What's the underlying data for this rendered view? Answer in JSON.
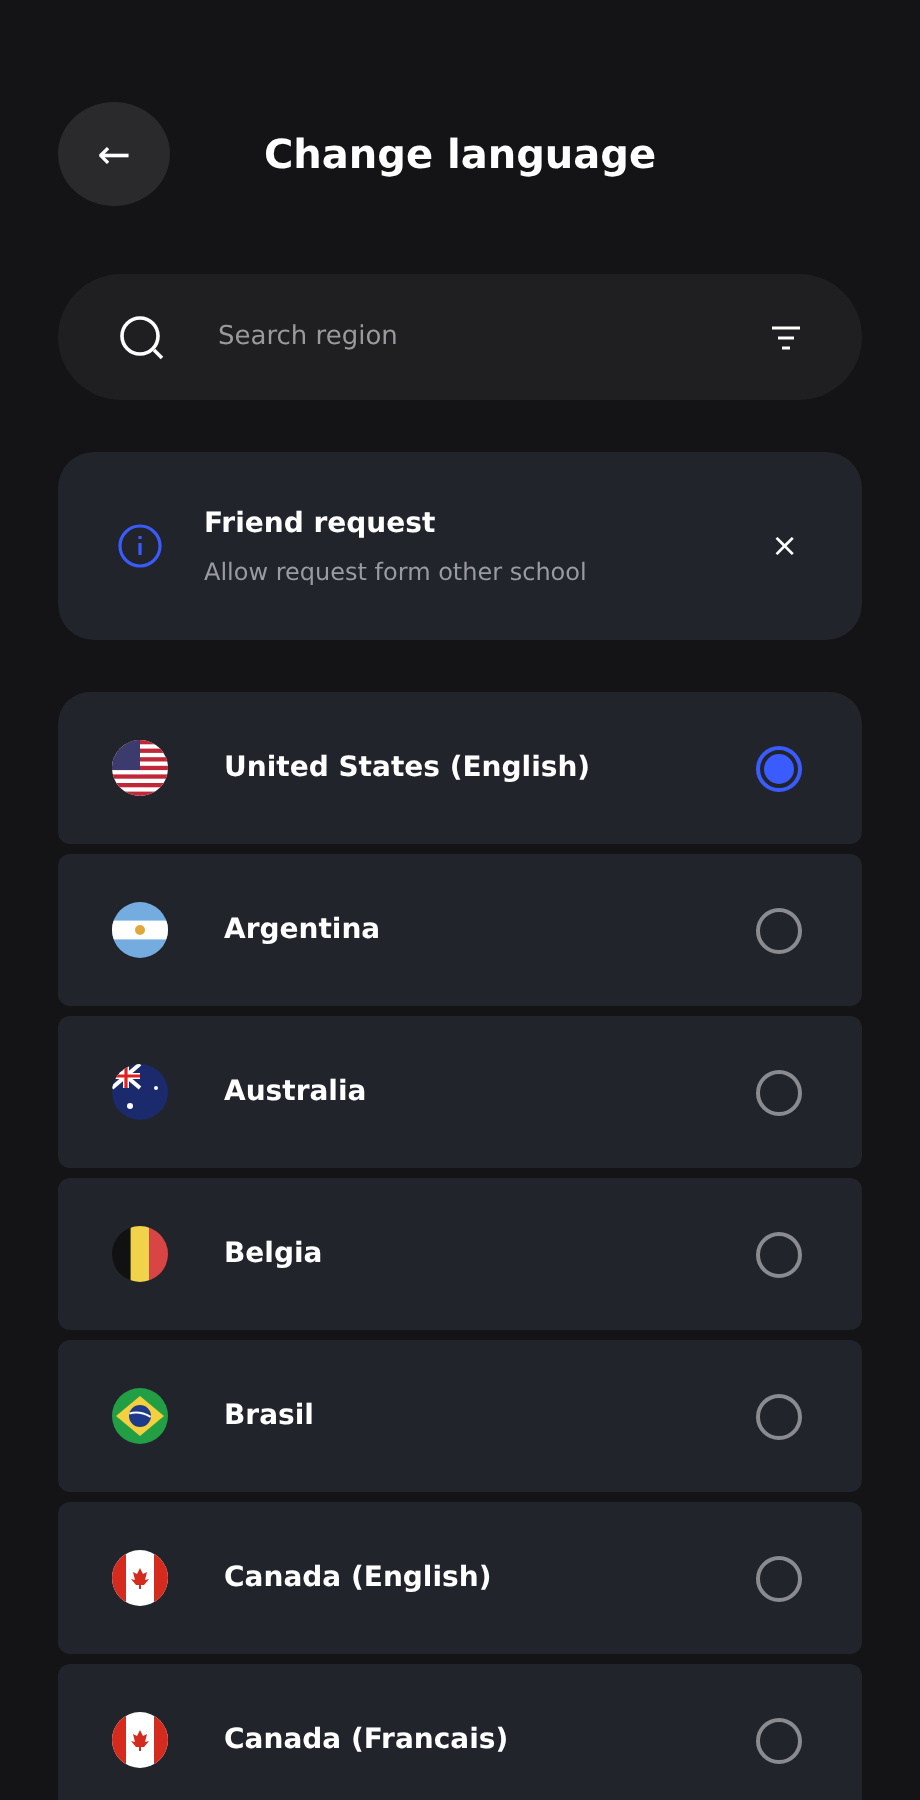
{
  "header": {
    "back_symbol": "←",
    "title": "Change language"
  },
  "search": {
    "placeholder": "Search region"
  },
  "notice": {
    "title": "Friend request",
    "message": "Allow request form other school",
    "close_symbol": "×"
  },
  "regions": [
    {
      "name": "United States (English)",
      "selected": true
    },
    {
      "name": "Argentina",
      "selected": false
    },
    {
      "name": "Australia",
      "selected": false
    },
    {
      "name": "Belgia",
      "selected": false
    },
    {
      "name": "Brasil",
      "selected": false
    },
    {
      "name": "Canada (English)",
      "selected": false
    },
    {
      "name": "Canada (Francais)",
      "selected": false
    }
  ]
}
